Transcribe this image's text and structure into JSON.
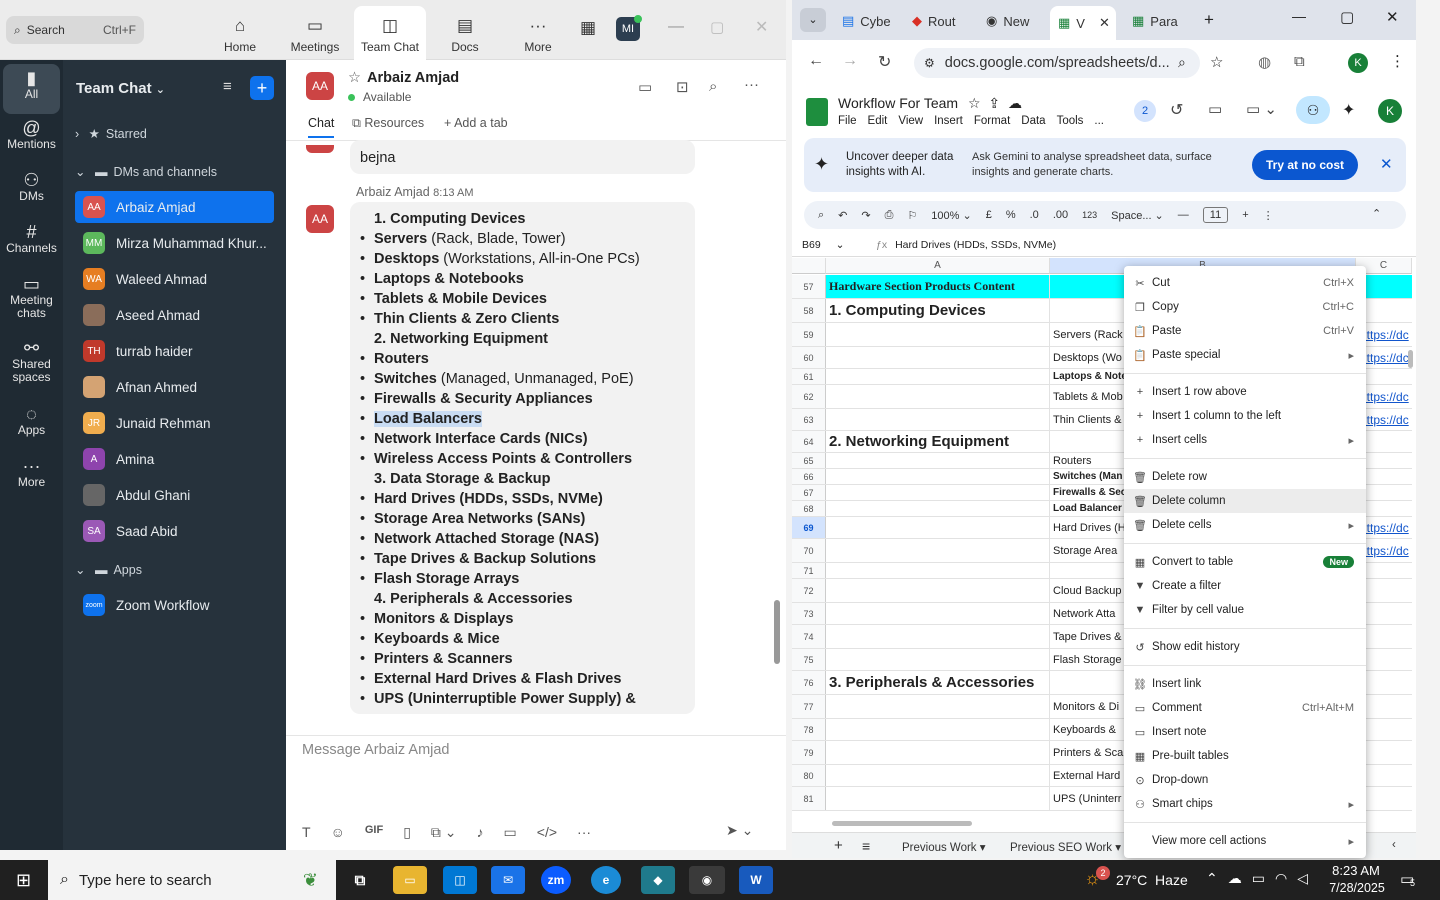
{
  "zoom": {
    "search": {
      "label": "Search",
      "shortcut": "Ctrl+F"
    },
    "tabs": [
      {
        "label": "Home",
        "icon": "home-icon"
      },
      {
        "label": "Meetings",
        "icon": "video-icon"
      },
      {
        "label": "Team Chat",
        "icon": "chat-icon"
      },
      {
        "label": "Docs",
        "icon": "doc-icon"
      },
      {
        "label": "More",
        "icon": "ellipsis-icon"
      }
    ],
    "avatar": "MI",
    "rail": [
      {
        "label": "All"
      },
      {
        "label": "Mentions"
      },
      {
        "label": "DMs"
      },
      {
        "label": "Channels"
      },
      {
        "label": "Meeting chats"
      },
      {
        "label": "Shared spaces"
      },
      {
        "label": "Apps"
      },
      {
        "label": "More"
      }
    ],
    "sidebar": {
      "title": "Team Chat",
      "starred": "Starred",
      "dms": "DMs and channels",
      "apps_section": "Apps",
      "contacts": [
        {
          "name": "Arbaiz Amjad",
          "initials": "AA",
          "color": "#d9534f"
        },
        {
          "name": "Mirza Muhammad Khur...",
          "initials": "MM",
          "color": "#5cb85c"
        },
        {
          "name": "Waleed Ahmad",
          "initials": "WA",
          "color": "#e67e22"
        },
        {
          "name": "Aseed Ahmad",
          "initials": "",
          "color": "#8a6d5a"
        },
        {
          "name": "turrab haider",
          "initials": "TH",
          "color": "#c0392b"
        },
        {
          "name": "Afnan Ahmed",
          "initials": "",
          "color": "#d4a373"
        },
        {
          "name": "Junaid Rehman",
          "initials": "JR",
          "color": "#f0ad4e"
        },
        {
          "name": "Amina",
          "initials": "A",
          "color": "#8e44ad"
        },
        {
          "name": "Abdul Ghani",
          "initials": "",
          "color": "#666666"
        },
        {
          "name": "Saad Abid",
          "initials": "SA",
          "color": "#9b59b6"
        }
      ],
      "app": {
        "name": "Zoom Workflow",
        "initials": "zoom"
      }
    },
    "chat": {
      "name": "Arbaiz Amjad",
      "initials": "AA",
      "status": "Available",
      "tabs": [
        "Chat",
        "Resources",
        "Add a tab"
      ],
      "prev_msg": "bejna",
      "sender_line": "Arbaiz Amjad",
      "time": "8:13 AM",
      "lines": [
        {
          "b": "",
          "bold": "1. Computing Devices",
          "rest": ""
        },
        {
          "b": "•",
          "bold": "Servers",
          "rest": " (Rack, Blade, Tower)"
        },
        {
          "b": "•",
          "bold": "Desktops",
          "rest": " (Workstations, All-in-One PCs)"
        },
        {
          "b": "•",
          "bold": "Laptops & Notebooks",
          "rest": ""
        },
        {
          "b": "•",
          "bold": "Tablets & Mobile Devices",
          "rest": ""
        },
        {
          "b": "•",
          "bold": "Thin Clients & Zero Clients",
          "rest": ""
        },
        {
          "b": "",
          "bold": "2. Networking Equipment",
          "rest": ""
        },
        {
          "b": "•",
          "bold": "Routers",
          "rest": ""
        },
        {
          "b": "•",
          "bold": "Switches",
          "rest": " (Managed, Unmanaged, PoE)"
        },
        {
          "b": "•",
          "bold": "Firewalls & Security Appliances",
          "rest": ""
        },
        {
          "b": "•",
          "bold": "Load Balancers",
          "rest": "",
          "hl": true
        },
        {
          "b": "•",
          "bold": "Network Interface Cards (NICs)",
          "rest": ""
        },
        {
          "b": "•",
          "bold": "Wireless Access Points & Controllers",
          "rest": ""
        },
        {
          "b": "",
          "bold": "3. Data Storage & Backup",
          "rest": ""
        },
        {
          "b": "•",
          "bold": "Hard Drives (HDDs, SSDs, NVMe)",
          "rest": ""
        },
        {
          "b": "•",
          "bold": "Storage Area Networks (SANs)",
          "rest": ""
        },
        {
          "b": "•",
          "bold": "Network Attached Storage (NAS)",
          "rest": ""
        },
        {
          "b": "•",
          "bold": "Tape Drives & Backup Solutions",
          "rest": ""
        },
        {
          "b": "•",
          "bold": "Flash Storage Arrays",
          "rest": ""
        },
        {
          "b": "",
          "bold": "4. Peripherals & Accessories",
          "rest": ""
        },
        {
          "b": "•",
          "bold": "Monitors & Displays",
          "rest": ""
        },
        {
          "b": "•",
          "bold": "Keyboards & Mice",
          "rest": ""
        },
        {
          "b": "•",
          "bold": "Printers & Scanners",
          "rest": ""
        },
        {
          "b": "•",
          "bold": "External Hard Drives & Flash Drives",
          "rest": ""
        },
        {
          "b": "•",
          "bold": "UPS (Uninterruptible Power Supply) &",
          "rest": ""
        }
      ],
      "composer_placeholder": "Message Arbaiz Amjad"
    }
  },
  "chrome": {
    "tabs": [
      "Cybe",
      "Rout",
      "New",
      "V",
      "Para"
    ],
    "url": "docs.google.com/spreadsheets/d...",
    "profile": "K",
    "doc": {
      "title": "Workflow For Team",
      "menus": [
        "File",
        "Edit",
        "View",
        "Insert",
        "Format",
        "Data",
        "Tools",
        "..."
      ],
      "collab_count": "2"
    },
    "banner": {
      "left": "Uncover deeper data insights with AI.",
      "right": "Ask Gemini to analyse spreadsheet data, surface insights and generate charts.",
      "button": "Try at no cost"
    },
    "toolbar": {
      "zoom": "100%",
      "currency": "£",
      "percent": "%",
      "dec_minus": ".0",
      "dec_plus": ".00",
      "num": "123",
      "font": "Space...",
      "size": "11"
    },
    "formula": {
      "ref": "B69",
      "content": "Hard Drives (HDDs, SSDs, NVMe)"
    },
    "columns": [
      "A",
      "B",
      "C"
    ],
    "rows": [
      {
        "n": "57",
        "h": 24,
        "a": "Hardware Section Products Content",
        "aStyle": "title",
        "b": "",
        "c": ""
      },
      {
        "n": "58",
        "h": 24,
        "a": "1. Computing Devices",
        "aStyle": "head",
        "b": "",
        "c": ""
      },
      {
        "n": "59",
        "h": 24,
        "a": "",
        "b": "Servers (Rack",
        "c": "https://dc"
      },
      {
        "n": "60",
        "h": 22,
        "a": "",
        "b": "Desktops (Wo",
        "c": "https://dc"
      },
      {
        "n": "61",
        "h": 16,
        "a": "",
        "b": "Laptops & Note",
        "bBold": true,
        "c": ""
      },
      {
        "n": "62",
        "h": 24,
        "a": "",
        "b": "Tablets & Mob",
        "c": "https://dc"
      },
      {
        "n": "63",
        "h": 22,
        "a": "",
        "b": "Thin Clients &",
        "c": "https://dc"
      },
      {
        "n": "64",
        "h": 22,
        "a": "2. Networking Equipment",
        "aStyle": "head",
        "b": "",
        "c": ""
      },
      {
        "n": "65",
        "h": 16,
        "a": "",
        "b": "Routers",
        "c": ""
      },
      {
        "n": "66",
        "h": 16,
        "a": "",
        "b": "Switches (Man",
        "bBold": true,
        "c": ""
      },
      {
        "n": "67",
        "h": 16,
        "a": "",
        "b": "Firewalls & Sec",
        "bBold": true,
        "c": ""
      },
      {
        "n": "68",
        "h": 16,
        "a": "",
        "b": "Load Balancer",
        "bBold": true,
        "c": ""
      },
      {
        "n": "69",
        "h": 22,
        "a": "",
        "b": "Hard Drives (H",
        "c": "https://dc",
        "sel": true
      },
      {
        "n": "70",
        "h": 24,
        "a": "",
        "b": "Storage Area",
        "c": "https://dc"
      },
      {
        "n": "71",
        "h": 16,
        "a": "",
        "b": "",
        "c": ""
      },
      {
        "n": "72",
        "h": 24,
        "a": "",
        "b": "Cloud Backup",
        "c": ""
      },
      {
        "n": "73",
        "h": 22,
        "a": "",
        "b": "Network Atta",
        "c": ""
      },
      {
        "n": "74",
        "h": 24,
        "a": "",
        "b": "Tape Drives &",
        "c": ""
      },
      {
        "n": "75",
        "h": 22,
        "a": "",
        "b": "Flash Storage",
        "c": ""
      },
      {
        "n": "76",
        "h": 24,
        "a": "3. Peripherals & Accessories",
        "aStyle": "head",
        "b": "",
        "c": ""
      },
      {
        "n": "77",
        "h": 24,
        "a": "",
        "b": "Monitors & Di",
        "c": ""
      },
      {
        "n": "78",
        "h": 22,
        "a": "",
        "b": "Keyboards &",
        "c": ""
      },
      {
        "n": "79",
        "h": 24,
        "a": "",
        "b": "Printers & Sca",
        "c": ""
      },
      {
        "n": "80",
        "h": 22,
        "a": "",
        "b": "External Hard",
        "c": ""
      },
      {
        "n": "81",
        "h": 24,
        "a": "",
        "b": "UPS (Uninterr",
        "c": ""
      }
    ],
    "sheets": [
      "Previous Work",
      "Previous SEO Work"
    ]
  },
  "context_menu": {
    "items": [
      {
        "label": "Cut",
        "icon": "scissors-icon",
        "shortcut": "Ctrl+X",
        "glyph": "✂"
      },
      {
        "label": "Copy",
        "icon": "copy-icon",
        "shortcut": "Ctrl+C",
        "glyph": "❐"
      },
      {
        "label": "Paste",
        "icon": "paste-icon",
        "shortcut": "Ctrl+V",
        "glyph": "📋"
      },
      {
        "label": "Paste special",
        "icon": "paste-special-icon",
        "shortcut": "▸",
        "glyph": "📋",
        "sepAfter": true
      },
      {
        "label": "Insert 1 row above",
        "icon": "plus-icon",
        "shortcut": "",
        "glyph": "+"
      },
      {
        "label": "Insert 1 column to the left",
        "icon": "plus-icon",
        "shortcut": "",
        "glyph": "+"
      },
      {
        "label": "Insert cells",
        "icon": "plus-icon",
        "shortcut": "▸",
        "glyph": "+",
        "sepAfter": true
      },
      {
        "label": "Delete row",
        "icon": "trash-icon",
        "shortcut": "",
        "glyph": "🗑"
      },
      {
        "label": "Delete column",
        "icon": "trash-icon",
        "shortcut": "",
        "glyph": "🗑",
        "hover": true
      },
      {
        "label": "Delete cells",
        "icon": "trash-icon",
        "shortcut": "▸",
        "glyph": "🗑",
        "sepAfter": true
      },
      {
        "label": "Convert to table",
        "icon": "table-icon",
        "shortcut": "",
        "glyph": "▦",
        "badge": "New"
      },
      {
        "label": "Create a filter",
        "icon": "filter-icon",
        "shortcut": "",
        "glyph": "▼"
      },
      {
        "label": "Filter by cell value",
        "icon": "filter-icon",
        "shortcut": "",
        "glyph": "▼",
        "sepAfter": true
      },
      {
        "label": "Show edit history",
        "icon": "history-icon",
        "shortcut": "",
        "glyph": "↺",
        "sepAfter": true
      },
      {
        "label": "Insert link",
        "icon": "link-icon",
        "shortcut": "",
        "glyph": "⛓"
      },
      {
        "label": "Comment",
        "icon": "comment-icon",
        "shortcut": "Ctrl+Alt+M",
        "glyph": "▭"
      },
      {
        "label": "Insert note",
        "icon": "note-icon",
        "shortcut": "",
        "glyph": "▭"
      },
      {
        "label": "Pre-built tables",
        "icon": "table-icon",
        "shortcut": "",
        "glyph": "▦"
      },
      {
        "label": "Drop-down",
        "icon": "dropdown-icon",
        "shortcut": "",
        "glyph": "⊙"
      },
      {
        "label": "Smart chips",
        "icon": "chip-icon",
        "shortcut": "▸",
        "glyph": "⚇",
        "sepAfter": true
      },
      {
        "label": "View more cell actions",
        "icon": "more-icon",
        "shortcut": "▸",
        "glyph": ""
      }
    ]
  },
  "taskbar": {
    "search_placeholder": "Type here to search",
    "weather": "27°C  Haze",
    "weather_badge": "2",
    "time": "8:23 AM",
    "date": "7/28/2025",
    "notif_count": "5"
  }
}
